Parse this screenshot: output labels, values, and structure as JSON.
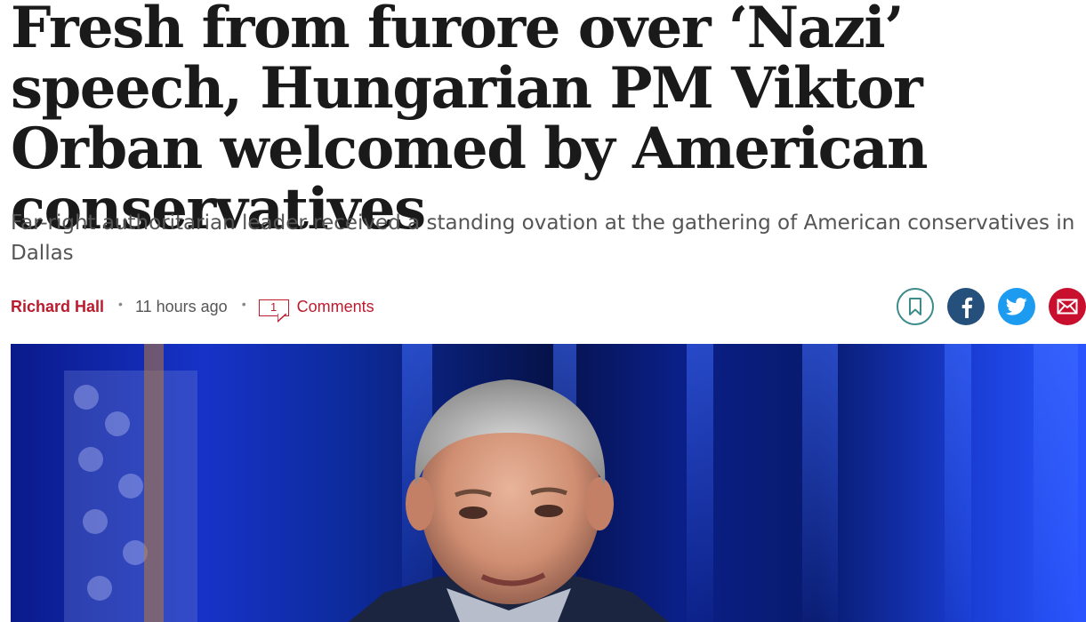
{
  "article": {
    "headline": "Fresh from furore over ‘Nazi’ speech, Hungarian PM Viktor Orban welcomed by American conservatives",
    "standfirst": "Far-right authoritarian leader received a standing ovation at the gathering of American conservatives in Dallas",
    "byline": {
      "author": "Richard Hall",
      "separator": "•",
      "time": "11 hours ago",
      "comment_count": "1",
      "comments_label": "Comments"
    }
  },
  "share": {
    "bookmark_icon": "bookmark-icon",
    "facebook_icon": "facebook-icon",
    "twitter_icon": "twitter-icon",
    "email_icon": "email-icon"
  },
  "colors": {
    "accent": "#ba1b2d",
    "headline": "#1a1a1a",
    "standfirst": "#555555",
    "bookmark": "#3d8b8a",
    "facebook": "#25507b",
    "twitter": "#1d9bf0",
    "email": "#c8102e"
  }
}
